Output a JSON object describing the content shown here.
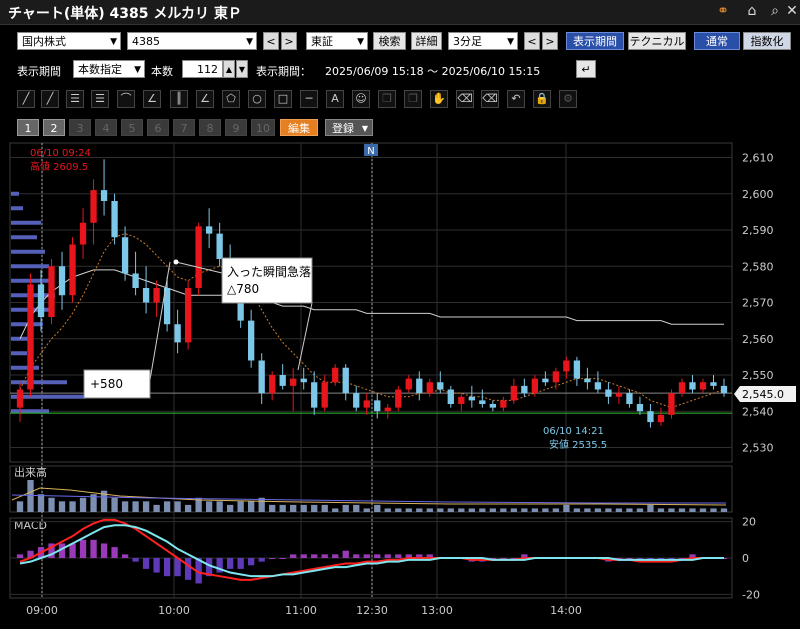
{
  "titlebar": {
    "title": "チャート(単体) 4385 メルカリ 東Ｐ",
    "icons": [
      "link-icon",
      "home-icon",
      "search-icon",
      "close-icon"
    ]
  },
  "toolbar1": {
    "market": "国内株式",
    "code": "4385",
    "exchange": "東証",
    "search": "検索",
    "detail": "詳細",
    "interval": "3分足",
    "period_btn": "表示期間",
    "technical_btn": "テクニカル",
    "normal_btn": "通常",
    "index_btn": "指数化"
  },
  "toolbar2": {
    "period_label": "表示期間",
    "mode": "本数指定",
    "count_label": "本数",
    "count": "112",
    "range_label": "表示期間：",
    "range": "2025/06/09 15:18 ～ 2025/06/10 15:15"
  },
  "pages": {
    "items": [
      "1",
      "2",
      "3",
      "4",
      "5",
      "6",
      "7",
      "8",
      "9",
      "10"
    ],
    "edit": "編集",
    "register": "登録"
  },
  "chart_data": [
    {
      "type": "candlestick",
      "title": "",
      "y_ticks": [
        2530,
        2540,
        2550,
        2560,
        2570,
        2580,
        2590,
        2600,
        2610
      ],
      "ylim": [
        2526,
        2614
      ],
      "current_price_label": "2,545.0",
      "high_label": [
        "06/10 09:24",
        "高値 2609.5"
      ],
      "low_label": [
        "06/10 14:21",
        "安値 2535.5"
      ],
      "annotations": [
        {
          "text": "入った瞬間急落",
          "sub": "△780"
        },
        {
          "text": "+580"
        }
      ],
      "marker": "N",
      "ohlc": [
        [
          2541,
          2548,
          2537,
          2546
        ],
        [
          2546,
          2578,
          2544,
          2575
        ],
        [
          2575,
          2579,
          2562,
          2566
        ],
        [
          2566,
          2582,
          2564,
          2580
        ],
        [
          2580,
          2584,
          2568,
          2572
        ],
        [
          2572,
          2588,
          2570,
          2586
        ],
        [
          2586,
          2596,
          2582,
          2592
        ],
        [
          2592,
          2604,
          2586,
          2601
        ],
        [
          2601,
          2609.5,
          2594,
          2598
        ],
        [
          2598,
          2600,
          2586,
          2588
        ],
        [
          2588,
          2591,
          2576,
          2578
        ],
        [
          2578,
          2584,
          2572,
          2574
        ],
        [
          2574,
          2580,
          2567,
          2570
        ],
        [
          2570,
          2576,
          2566,
          2574
        ],
        [
          2574,
          2577,
          2562,
          2564
        ],
        [
          2564,
          2568,
          2556,
          2559
        ],
        [
          2559,
          2576,
          2557,
          2574
        ],
        [
          2574,
          2592,
          2572,
          2591
        ],
        [
          2591,
          2596,
          2585,
          2589
        ],
        [
          2589,
          2592,
          2580,
          2582
        ],
        [
          2582,
          2586,
          2571,
          2573
        ],
        [
          2573,
          2576,
          2563,
          2565
        ],
        [
          2565,
          2568,
          2552,
          2554
        ],
        [
          2554,
          2556,
          2542,
          2545
        ],
        [
          2545,
          2551,
          2543,
          2550
        ],
        [
          2550,
          2553,
          2546,
          2547
        ],
        [
          2547,
          2552,
          2540,
          2549
        ],
        [
          2549,
          2552,
          2546,
          2548
        ],
        [
          2548,
          2551,
          2539,
          2541
        ],
        [
          2541,
          2550,
          2540,
          2548
        ],
        [
          2548,
          2553,
          2547,
          2552
        ],
        [
          2552,
          2553,
          2543,
          2545
        ],
        [
          2545,
          2547,
          2540,
          2541
        ],
        [
          2541,
          2545,
          2539,
          2543
        ],
        [
          2543,
          2545,
          2538,
          2540
        ],
        [
          2540,
          2542,
          2538,
          2541
        ],
        [
          2541,
          2547,
          2540,
          2546
        ],
        [
          2546,
          2550,
          2545,
          2549
        ],
        [
          2549,
          2551,
          2543,
          2545
        ],
        [
          2545,
          2549,
          2544,
          2548
        ],
        [
          2548,
          2551,
          2545,
          2546
        ],
        [
          2546,
          2547,
          2541,
          2542
        ],
        [
          2542,
          2545,
          2540,
          2544
        ],
        [
          2544,
          2547,
          2541,
          2543
        ],
        [
          2543,
          2546,
          2541,
          2542
        ],
        [
          2542,
          2543,
          2540,
          2541
        ],
        [
          2541,
          2544,
          2540,
          2543
        ],
        [
          2543,
          2549,
          2542,
          2547
        ],
        [
          2547,
          2549,
          2544,
          2545
        ],
        [
          2545,
          2550,
          2544,
          2549
        ],
        [
          2549,
          2551,
          2547,
          2548
        ],
        [
          2548,
          2552,
          2546,
          2551
        ],
        [
          2551,
          2555,
          2549,
          2554
        ],
        [
          2554,
          2555,
          2547,
          2549
        ],
        [
          2549,
          2552,
          2546,
          2548
        ],
        [
          2548,
          2551,
          2545,
          2546
        ],
        [
          2546,
          2548,
          2542,
          2544
        ],
        [
          2544,
          2547,
          2542,
          2545
        ],
        [
          2545,
          2546,
          2541,
          2542
        ],
        [
          2542,
          2544,
          2539,
          2540
        ],
        [
          2540,
          2542,
          2535.5,
          2537
        ],
        [
          2537,
          2541,
          2536,
          2539
        ],
        [
          2539,
          2546,
          2538,
          2545
        ],
        [
          2545,
          2549,
          2544,
          2548
        ],
        [
          2548,
          2550,
          2545,
          2546
        ],
        [
          2546,
          2549,
          2545,
          2548
        ],
        [
          2548,
          2550,
          2546,
          2547
        ],
        [
          2547,
          2549,
          2544,
          2545
        ]
      ],
      "ma_short": [
        2546,
        2552,
        2556,
        2560,
        2563,
        2567,
        2572,
        2578,
        2584,
        2588,
        2589,
        2588,
        2586,
        2583,
        2580,
        2577,
        2576,
        2578,
        2579,
        2580,
        2579,
        2577,
        2573,
        2568,
        2563,
        2559,
        2556,
        2553,
        2550,
        2548,
        2548,
        2548,
        2547,
        2546,
        2545,
        2544,
        2544,
        2544,
        2545,
        2545,
        2546,
        2545,
        2545,
        2544,
        2544,
        2543,
        2543,
        2543,
        2544,
        2545,
        2546,
        2547,
        2548,
        2549,
        2549,
        2549,
        2548,
        2547,
        2546,
        2545,
        2543,
        2542,
        2541,
        2542,
        2543,
        2544,
        2545,
        2546
      ],
      "ma_long": [
        2560,
        2566,
        2570,
        2573,
        2575,
        2577,
        2578,
        2579,
        2579,
        2579,
        2578,
        2577,
        2576,
        2575,
        2574,
        2573,
        2572,
        2572,
        2572,
        2572,
        2572,
        2571,
        2571,
        2570,
        2570,
        2569,
        2569,
        2569,
        2568,
        2568,
        2568,
        2568,
        2568,
        2567,
        2567,
        2567,
        2567,
        2567,
        2567,
        2567,
        2566,
        2566,
        2566,
        2566,
        2566,
        2566,
        2566,
        2566,
        2566,
        2566,
        2566,
        2566,
        2566,
        2565,
        2565,
        2565,
        2565,
        2565,
        2565,
        2565,
        2565,
        2565,
        2564,
        2564,
        2564,
        2564,
        2564,
        2564
      ]
    },
    {
      "type": "bar",
      "title": "出来高",
      "values": [
        3,
        9,
        5,
        4,
        3,
        3,
        4,
        5,
        6,
        4,
        3,
        3,
        3,
        2,
        3,
        3,
        2,
        4,
        3,
        3,
        2,
        3,
        3,
        4,
        2,
        2,
        2,
        2,
        2,
        2,
        1,
        2,
        2,
        1,
        2,
        1,
        1,
        1,
        1,
        1,
        1,
        1,
        1,
        1,
        1,
        1,
        1,
        1,
        1,
        1,
        1,
        1,
        2,
        1,
        1,
        1,
        1,
        1,
        1,
        1,
        2,
        1,
        1,
        1,
        1,
        1,
        1,
        1
      ]
    },
    {
      "type": "line",
      "title": "MACD",
      "y_ticks": [
        20,
        0,
        -20
      ],
      "ylim": [
        -22,
        22
      ],
      "macd": [
        -2,
        0,
        3,
        6,
        9,
        12,
        16,
        19,
        21,
        21,
        19,
        16,
        12,
        8,
        4,
        0,
        -4,
        -8,
        -9,
        -10,
        -11,
        -12,
        -12,
        -11,
        -10,
        -9,
        -8,
        -7,
        -6,
        -5,
        -4,
        -3,
        -3,
        -2,
        -2,
        -1,
        -1,
        0,
        0,
        0,
        0,
        0,
        0,
        -1,
        -1,
        -1,
        -1,
        -1,
        0,
        0,
        0,
        0,
        0,
        0,
        0,
        0,
        -1,
        -1,
        -1,
        -2,
        -2,
        -2,
        -2,
        -1,
        0,
        0,
        0,
        0
      ],
      "signal": [
        -3,
        -2,
        0,
        2,
        5,
        8,
        11,
        14,
        17,
        18,
        18,
        17,
        15,
        12,
        9,
        5,
        2,
        -1,
        -4,
        -6,
        -8,
        -9,
        -10,
        -10,
        -10,
        -9,
        -9,
        -8,
        -7,
        -6,
        -5,
        -5,
        -4,
        -3,
        -3,
        -2,
        -2,
        -1,
        -1,
        -1,
        0,
        0,
        0,
        0,
        0,
        -1,
        -1,
        -1,
        -1,
        0,
        0,
        0,
        0,
        0,
        0,
        0,
        0,
        -1,
        -1,
        -1,
        -1,
        -1,
        -1,
        -1,
        -1,
        0,
        0,
        0
      ]
    },
    {
      "type": "axis",
      "x_ticks": [
        "09:00",
        "10:00",
        "11:00",
        "12:30",
        "13:00",
        "14:00"
      ]
    }
  ],
  "colors": {
    "up": "#e8161c",
    "down": "#7dc8e8",
    "ma_short": "#c97b2a",
    "ma_long": "#d0d0d0",
    "macd": "#ff2020",
    "signal": "#7ee6ee",
    "volume_profile": "#5560b8",
    "toolbar_blue": "#2a4fa8",
    "edit": "#e67e22"
  }
}
